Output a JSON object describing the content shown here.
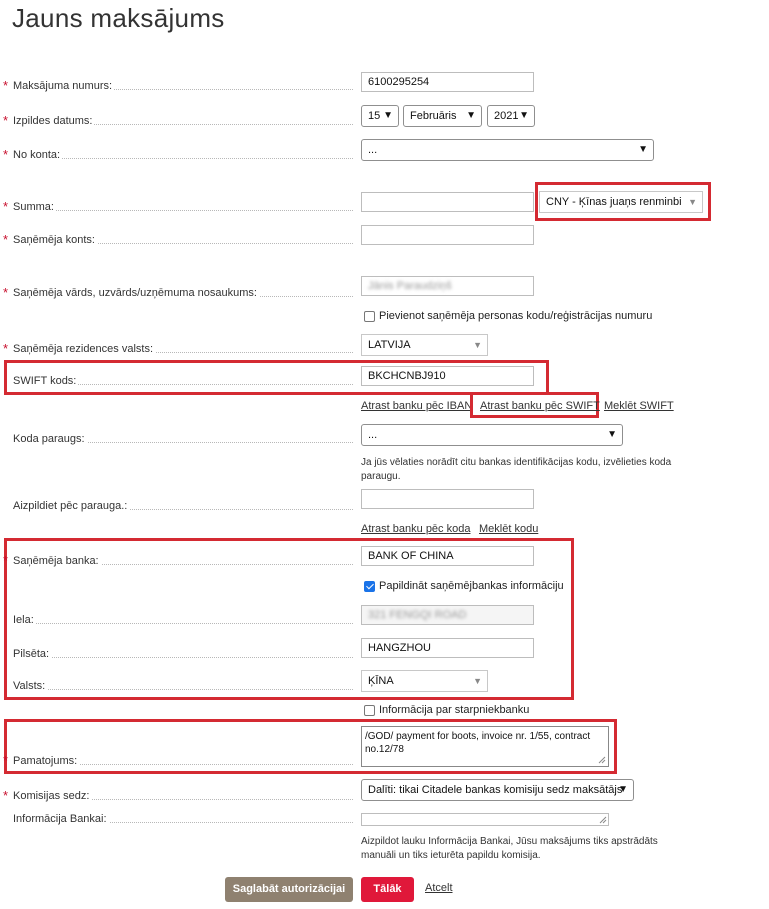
{
  "page": {
    "title": "Jauns maksājums"
  },
  "fields": {
    "payment_number": {
      "label": "Maksājuma numurs:",
      "value": "6100295254"
    },
    "execution_date": {
      "label": "Izpildes datums:",
      "day": "15",
      "month": "Februāris",
      "year": "2021"
    },
    "from_account": {
      "label": "No konta:",
      "value": "..."
    },
    "amount": {
      "label": "Summa:",
      "value": "",
      "currency": "CNY - Ķīnas juaņs renminbi"
    },
    "recipient_account": {
      "label": "Saņēmēja konts:",
      "value": ""
    },
    "recipient_name": {
      "label": "Saņēmēja vārds, uzvārds/uzņēmuma nosaukums:",
      "value": "Jānis Paraudziņš"
    },
    "add_personal_code": {
      "label": "Pievienot saņēmēja personas kodu/reģistrācijas numuru",
      "checked": false
    },
    "residence_country": {
      "label": "Saņēmēja rezidences valsts:",
      "value": "LATVIJA"
    },
    "swift": {
      "label": "SWIFT kods:",
      "value": "BKCHCNBJ910"
    },
    "swift_links": {
      "by_iban": "Atrast banku pēc IBAN",
      "by_swift": "Atrast banku pēc SWIFT",
      "search_swift": "Meklēt SWIFT"
    },
    "code_sample": {
      "label": "Koda paraugs:",
      "value": "...",
      "note": "Ja jūs vēlaties norādīt citu bankas identifikācijas kodu, izvēlieties koda paraugu."
    },
    "fill_by_sample": {
      "label": "Aizpildiet pēc parauga.:",
      "value": ""
    },
    "code_links": {
      "by_code": "Atrast banku pēc koda",
      "search_code": "Meklēt kodu"
    },
    "recipient_bank": {
      "label": "Saņēmēja banka:",
      "value": "BANK OF CHINA"
    },
    "supplement_bank_info": {
      "label": "Papildināt saņēmējbankas informāciju",
      "checked": true
    },
    "street": {
      "label": "Iela:",
      "value": "321 FENGQI ROAD"
    },
    "city": {
      "label": "Pilsēta:",
      "value": "HANGZHOU"
    },
    "country": {
      "label": "Valsts:",
      "value": "ĶĪNA"
    },
    "intermediary_info": {
      "label": "Informācija par starpniekbanku",
      "checked": false
    },
    "purpose": {
      "label": "Pamatojums:",
      "value": "/GOD/ payment for boots, invoice nr. 1/55, contract no.12/78"
    },
    "commission": {
      "label": "Komisijas sedz:",
      "value": "Dalīti: tikai Citadele bankas komisiju sedz maksātājs"
    },
    "bank_info": {
      "label": "Informācija Bankai:",
      "value": "",
      "note": "Aizpildot lauku Informācija Bankai, Jūsu maksājums tiks apstrādāts manuāli un tiks ieturēta papildu komisija."
    }
  },
  "actions": {
    "save": "Saglabāt autorizācijai",
    "next": "Tālāk",
    "cancel": "Atcelt"
  },
  "colors": {
    "highlight": "#d42a32",
    "next_button": "#e0183a",
    "save_button": "#8f8170",
    "required_star": "#c8102e"
  }
}
